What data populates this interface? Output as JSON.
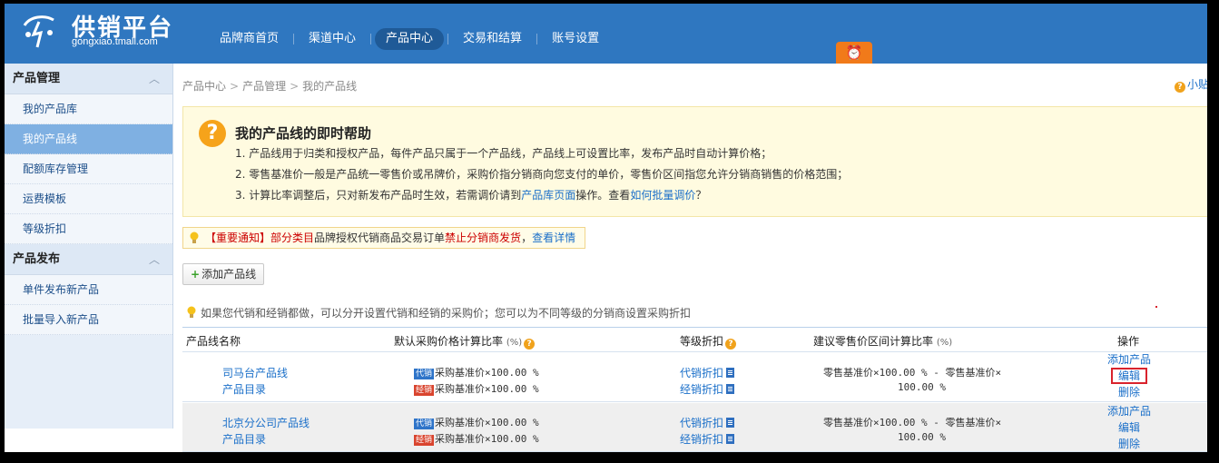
{
  "brand": {
    "title": "供销平台",
    "subtitle": "gongxiao.tmall.com"
  },
  "nav": {
    "items": [
      "品牌商首页",
      "渠道中心",
      "产品中心",
      "交易和结算",
      "账号设置"
    ],
    "active_index": 2
  },
  "sidebar": {
    "sections": [
      {
        "title": "产品管理",
        "items": [
          "我的产品库",
          "我的产品线",
          "配额库存管理",
          "运费模板",
          "等级折扣"
        ]
      },
      {
        "title": "产品发布",
        "items": [
          "单件发布新产品",
          "批量导入新产品"
        ]
      }
    ],
    "active_item": "我的产品线"
  },
  "breadcrumb": [
    "产品中心",
    "产品管理",
    "我的产品线"
  ],
  "tips_label": "小贴士",
  "help": {
    "title": "我的产品线的即时帮助",
    "line1": "1. 产品线用于归类和授权产品，每件产品只属于一个产品线，产品线上可设置比率，发布产品时自动计算价格；",
    "line2": "2. 零售基准价一般是产品统一零售价或吊牌价，采购价指分销商向您支付的单价，零售价区间指您允许分销商销售的价格范围；",
    "line3_a": "3. 计算比率调整后，只对新发布产品时生效，若需调价请到",
    "line3_link1": "产品库页面",
    "line3_b": "操作。查看",
    "line3_link2": "如何批量调价",
    "line3_c": "？"
  },
  "notice": {
    "tag": "【重要通知】",
    "part1": "部分类目",
    "part2": "品牌授权代销商品交易订单",
    "part3": "禁止分销商发货",
    "part4": "，",
    "link": "查看详情"
  },
  "add_button": "添加产品线",
  "hint": "如果您代销和经销都做，可以分开设置代销和经销的采购价；您可以为不同等级的分销商设置采购折扣",
  "table": {
    "headers": {
      "name": "产品线名称",
      "purchase": "默认采购价格计算比率",
      "purchase_unit": "(%)",
      "discount": "等级折扣",
      "retail": "建议零售价区间计算比率",
      "retail_unit": "(%)",
      "ops": "操作"
    },
    "tag_daixiao": "代销",
    "tag_jingxiao": "经销",
    "rows": [
      {
        "name": "司马台产品线",
        "catalog": "产品目录",
        "daixiao_rate": "采购基准价×100.00 %",
        "jingxiao_rate": "采购基准价×100.00 %",
        "daixiao_discount": "代销折扣",
        "jingxiao_discount": "经销折扣",
        "retail_line1": "零售基准价×100.00 % - 零售基准价×",
        "retail_line2": "100.00 %",
        "op_add": "添加产品",
        "op_edit": "编辑",
        "op_delete": "删除"
      },
      {
        "name": "北京分公司产品线",
        "catalog": "产品目录",
        "daixiao_rate": "采购基准价×100.00 %",
        "jingxiao_rate": "采购基准价×100.00 %",
        "daixiao_discount": "代销折扣",
        "jingxiao_discount": "经销折扣",
        "retail_line1": "零售基准价×100.00 % - 零售基准价×",
        "retail_line2": "100.00 %",
        "op_add": "添加产品",
        "op_edit": "编辑",
        "op_delete": "删除"
      }
    ]
  },
  "colors": {
    "header_bg": "#2f77c0",
    "link": "#1a6fc9",
    "alert_red": "#cc0000",
    "help_bg": "#fffbe0"
  }
}
